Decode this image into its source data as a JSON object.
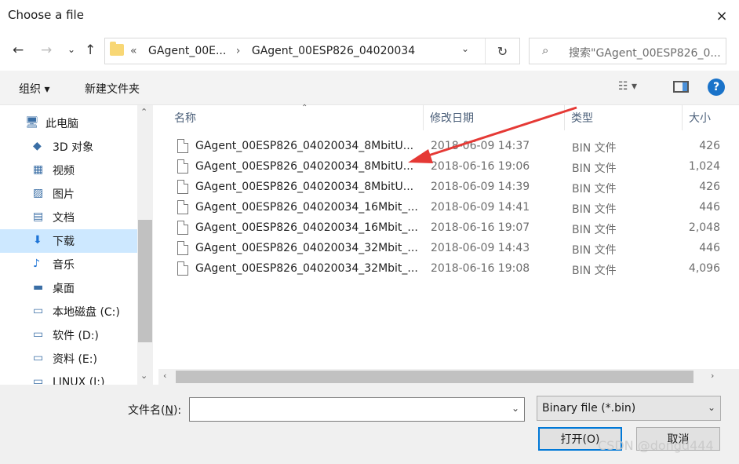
{
  "window": {
    "title": "Choose a file",
    "close_icon": "×"
  },
  "nav": {
    "back": "←",
    "forward": "→",
    "recent": "⌄",
    "up": "↑",
    "address": {
      "overflow": "«",
      "crumb1": "GAgent_00E...",
      "sep": "›",
      "crumb2": "GAgent_00ESP826_04020034",
      "dropdown": "⌄",
      "refresh": "↻"
    },
    "search_placeholder": "搜索\"GAgent_00ESP826_0..."
  },
  "toolbar": {
    "organize": "组织 ▾",
    "new_folder": "新建文件夹",
    "view": "☷ ▾",
    "help": "?"
  },
  "sidebar": {
    "items": [
      {
        "label": "此电脑",
        "icon": "computer-icon"
      },
      {
        "label": "3D 对象",
        "icon": "cube-icon"
      },
      {
        "label": "视频",
        "icon": "video-icon"
      },
      {
        "label": "图片",
        "icon": "picture-icon"
      },
      {
        "label": "文档",
        "icon": "document-icon"
      },
      {
        "label": "下载",
        "icon": "download-icon"
      },
      {
        "label": "音乐",
        "icon": "music-icon"
      },
      {
        "label": "桌面",
        "icon": "desktop-icon"
      },
      {
        "label": "本地磁盘 (C:)",
        "icon": "drive-icon"
      },
      {
        "label": "软件 (D:)",
        "icon": "drive-icon"
      },
      {
        "label": "资料 (E:)",
        "icon": "drive-icon"
      },
      {
        "label": "LINUX (I:)",
        "icon": "drive-icon"
      }
    ],
    "selected_index": 5,
    "scroll_up": "⌃",
    "scroll_down": "⌄"
  },
  "columns": {
    "name": "名称",
    "date": "修改日期",
    "type": "类型",
    "size": "大小",
    "sort_indicator": "⌃"
  },
  "files": [
    {
      "name": "GAgent_00ESP826_04020034_8MbitU...",
      "date": "2018-06-09 14:37",
      "type": "BIN 文件",
      "size": "426"
    },
    {
      "name": "GAgent_00ESP826_04020034_8MbitU...",
      "date": "2018-06-16 19:06",
      "type": "BIN 文件",
      "size": "1,024"
    },
    {
      "name": "GAgent_00ESP826_04020034_8MbitU...",
      "date": "2018-06-09 14:39",
      "type": "BIN 文件",
      "size": "426"
    },
    {
      "name": "GAgent_00ESP826_04020034_16Mbit_...",
      "date": "2018-06-09 14:41",
      "type": "BIN 文件",
      "size": "446"
    },
    {
      "name": "GAgent_00ESP826_04020034_16Mbit_...",
      "date": "2018-06-16 19:07",
      "type": "BIN 文件",
      "size": "2,048"
    },
    {
      "name": "GAgent_00ESP826_04020034_32Mbit_...",
      "date": "2018-06-09 14:43",
      "type": "BIN 文件",
      "size": "446"
    },
    {
      "name": "GAgent_00ESP826_04020034_32Mbit_...",
      "date": "2018-06-16 19:08",
      "type": "BIN 文件",
      "size": "4,096"
    }
  ],
  "hscroll": {
    "left": "‹",
    "right": "›"
  },
  "footer": {
    "filename_label_prefix": "文件名(",
    "filename_label_key": "N",
    "filename_label_suffix": "):",
    "filename_value": "",
    "filter_value": "Binary file (*.bin)",
    "open_label": "打开(O)",
    "cancel_label": "取消",
    "watermark": "CSDN @dongd444"
  },
  "colors": {
    "selected_bg": "#cde8ff",
    "annotation_arrow": "#e53935",
    "accent": "#0078d7"
  }
}
